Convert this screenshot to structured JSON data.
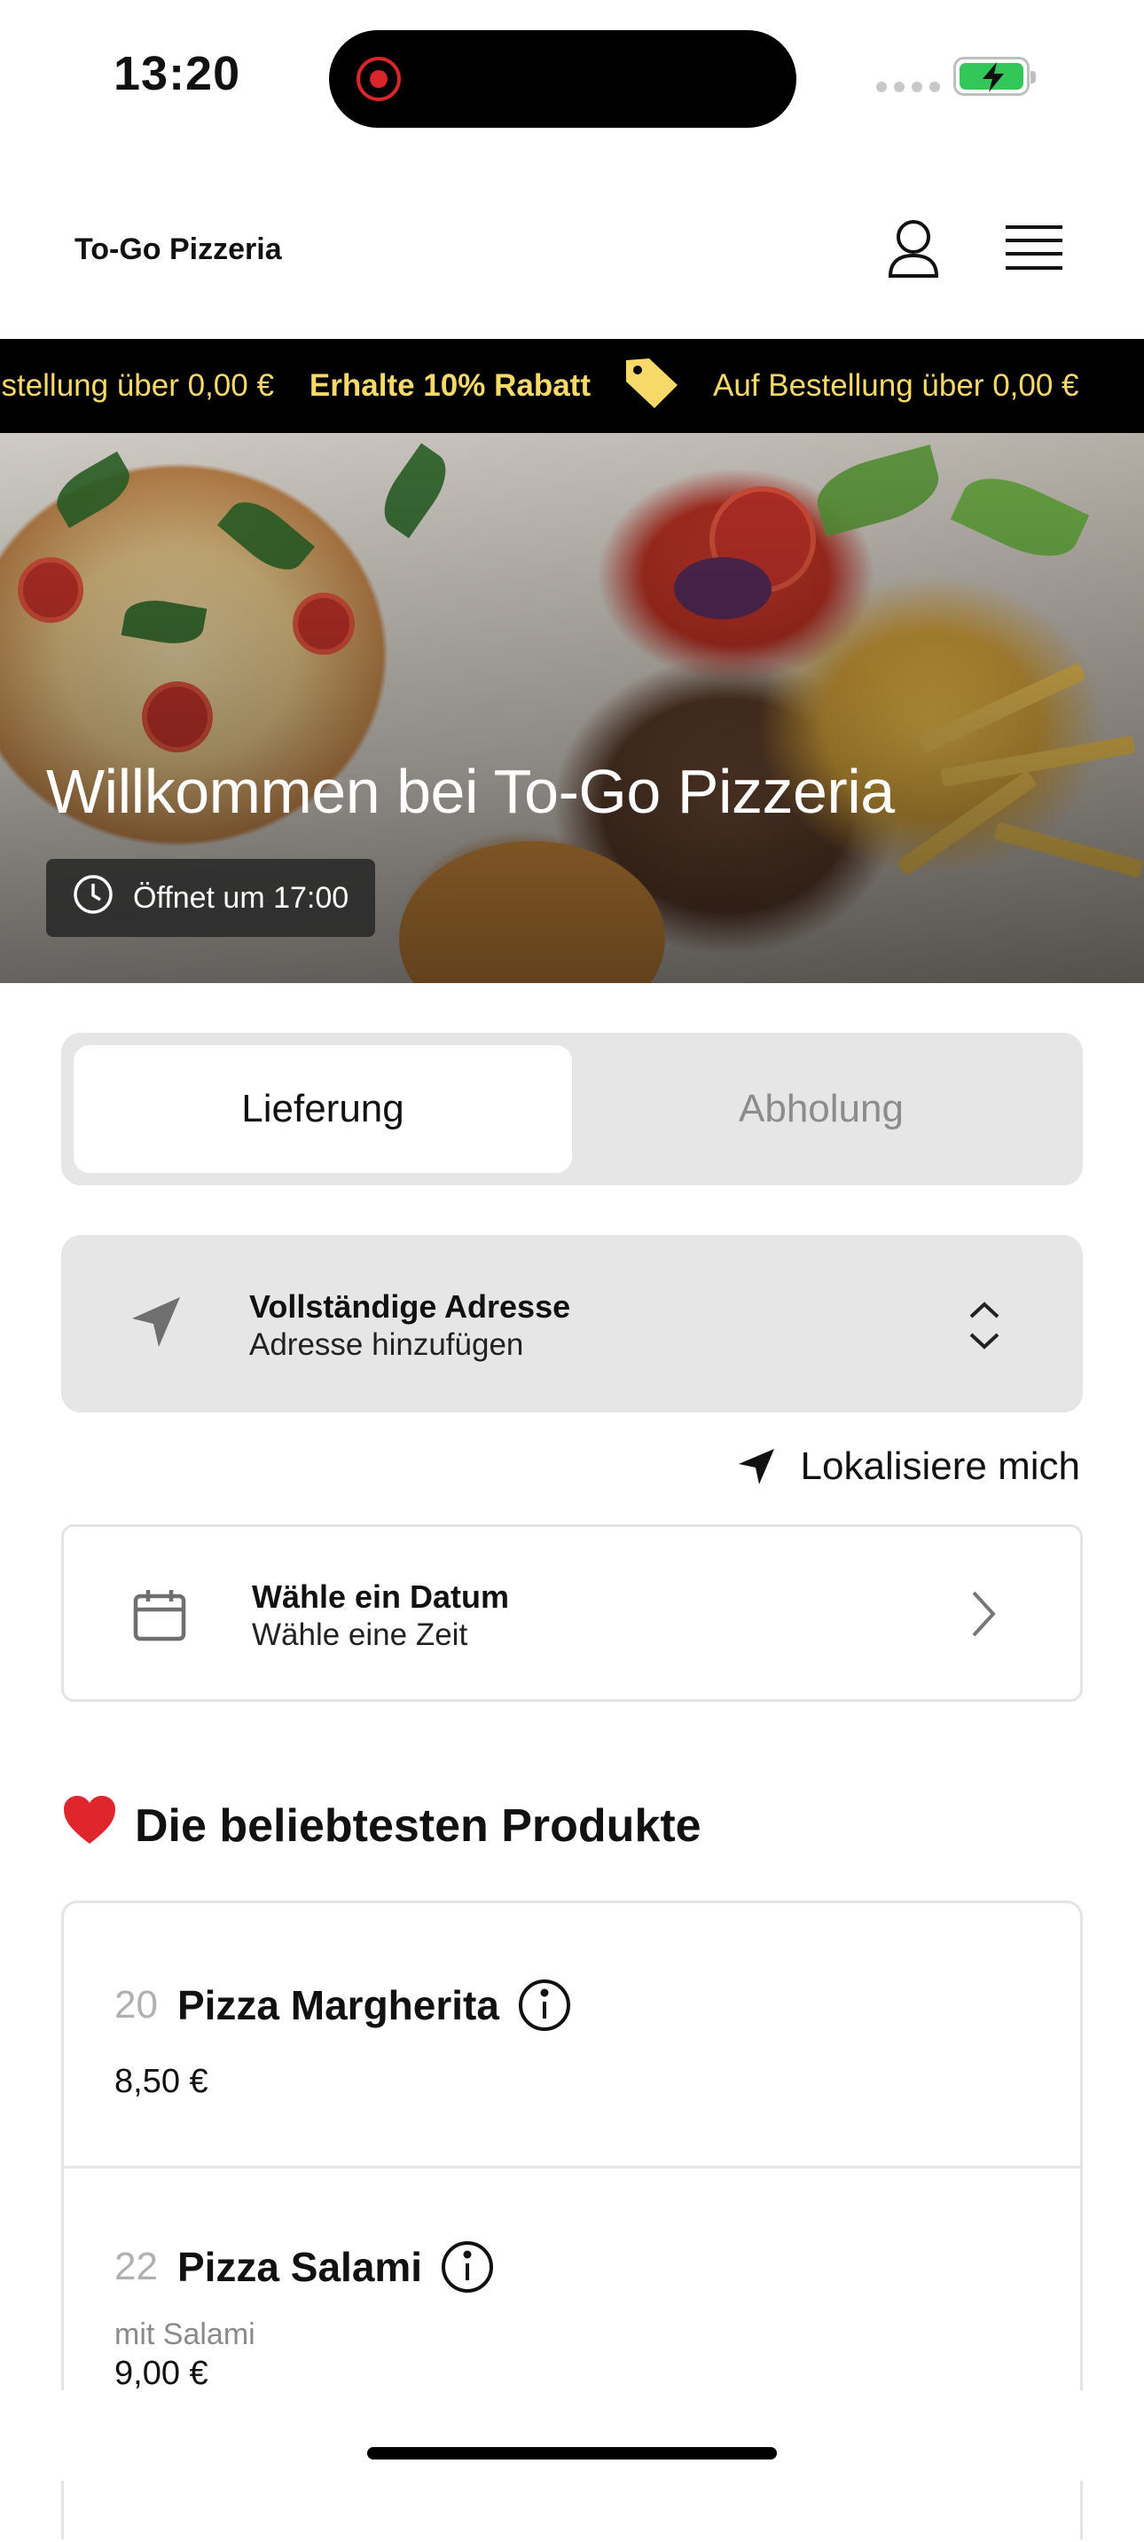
{
  "status_bar": {
    "time": "13:20"
  },
  "header": {
    "brand": "To-Go Pizzeria"
  },
  "ticker": {
    "lead": "estellung über 0,00 €",
    "bold": "Erhalte 10% Rabatt",
    "trail": "Auf Bestellung über 0,00 €"
  },
  "hero": {
    "title": "Willkommen bei To-Go Pizzeria",
    "hours": "Öffnet um 17:00"
  },
  "order_mode": {
    "delivery": "Lieferung",
    "pickup": "Abholung",
    "selected": "Lieferung"
  },
  "address": {
    "title": "Vollständige Adresse",
    "subtitle": "Adresse hinzufügen"
  },
  "locate_label": "Lokalisiere mich",
  "schedule": {
    "title": "Wähle ein Datum",
    "subtitle": "Wähle eine Zeit"
  },
  "popular": {
    "title": "Die beliebtesten Produkte",
    "products": [
      {
        "number": "20",
        "name": "Pizza Margherita",
        "description": "",
        "price": "8,50 €"
      },
      {
        "number": "22",
        "name": "Pizza Salami",
        "description": "mit Salami",
        "price": "9,00 €"
      }
    ]
  },
  "colors": {
    "ticker_text": "#f7d96a",
    "ticker_bg": "#000000",
    "panel_bg": "#e6e6e6"
  },
  "icons": [
    "record-icon",
    "battery-icon",
    "user-icon",
    "menu-icon",
    "price-tag-icon",
    "clock-icon",
    "location-arrow-icon",
    "chevron-up-down-icon",
    "calendar-icon",
    "chevron-right-icon",
    "heart-icon",
    "info-icon"
  ]
}
